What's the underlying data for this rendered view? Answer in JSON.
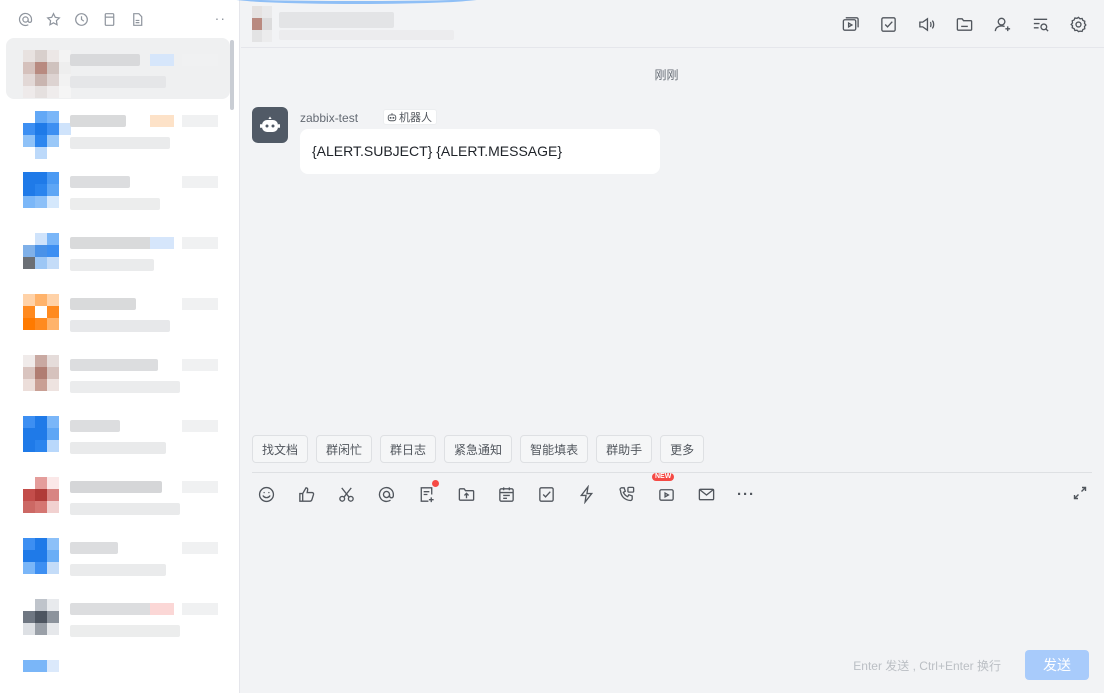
{
  "sidebar": {
    "toolbar_icons": [
      "at-icon",
      "star-icon",
      "clock-icon",
      "bookmark-icon",
      "document-icon"
    ],
    "more_label": "··"
  },
  "chat": {
    "time_divider": "刚刚",
    "message": {
      "sender": "zabbix-test",
      "tag": "机器人",
      "text": "{ALERT.SUBJECT} {ALERT.MESSAGE}"
    }
  },
  "quick_actions": [
    "找文档",
    "群闲忙",
    "群日志",
    "紧急通知",
    "智能填表",
    "群助手",
    "更多"
  ],
  "composer": {
    "new_badge": "NEW",
    "hint": "Enter 发送 , Ctrl+Enter 换行",
    "send_label": "发送",
    "more_label": "···"
  },
  "colors": {
    "accent": "#3370ff",
    "send_disabled": "#a8cbfb",
    "notify_red": "#f54a45",
    "bot_avatar": "#515a66"
  }
}
